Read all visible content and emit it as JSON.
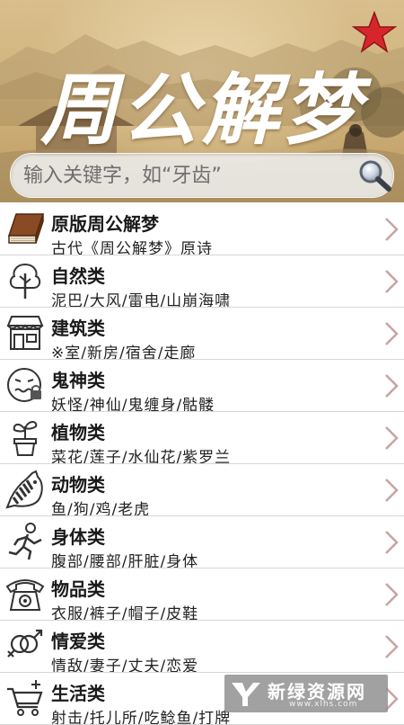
{
  "header": {
    "title": "周公解梦",
    "search": {
      "placeholder": "输入关键字，如“牙齿”",
      "value": ""
    },
    "icons": {
      "favorite": "star-icon",
      "search": "magnifier-icon"
    },
    "colors": {
      "star": "#d7262b"
    }
  },
  "categories": [
    {
      "title": "原版周公解梦",
      "subtitle": "古代《周公解梦》原诗",
      "icon": "book-icon"
    },
    {
      "title": "自然类",
      "subtitle": "泥巴/大风/雷电/山崩海啸",
      "icon": "tree-icon"
    },
    {
      "title": "建筑类",
      "subtitle": "※室/新房/宿舍/走廊",
      "icon": "shop-icon"
    },
    {
      "title": "鬼神类",
      "subtitle": "妖怪/神仙/鬼缠身/骷髅",
      "icon": "ghost-face-icon"
    },
    {
      "title": "植物类",
      "subtitle": "菜花/莲子/水仙花/紫罗兰",
      "icon": "potted-plant-icon"
    },
    {
      "title": "动物类",
      "subtitle": "鱼/狗/鸡/老虎",
      "icon": "zebra-icon"
    },
    {
      "title": "身体类",
      "subtitle": "腹部/腰部/肝脏/身体",
      "icon": "running-person-icon"
    },
    {
      "title": "物品类",
      "subtitle": "衣服/裤子/帽子/皮鞋",
      "icon": "telephone-icon"
    },
    {
      "title": "情爱类",
      "subtitle": "情敌/妻子/丈夫/恋爱",
      "icon": "gender-icon"
    },
    {
      "title": "生活类",
      "subtitle": "射击/托儿所/吃鲶鱼/打牌",
      "icon": "shopping-cart-icon"
    }
  ],
  "watermark": {
    "text": "新绿资源网",
    "url": "www.xlhs.com"
  }
}
